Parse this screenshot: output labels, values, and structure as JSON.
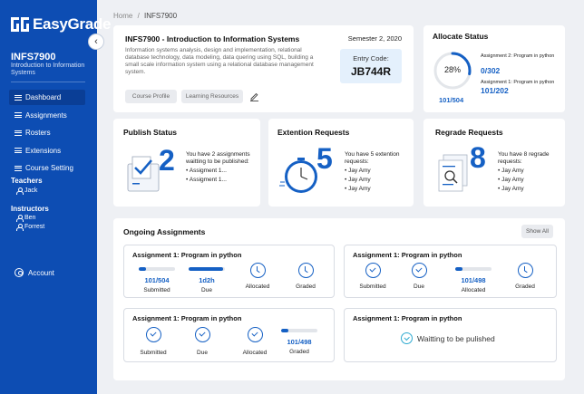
{
  "app": {
    "name": "EasyGrade"
  },
  "course": {
    "code": "INFS7900",
    "name": "Introduction to Information Systems"
  },
  "nav": [
    {
      "label": "Dashboard",
      "active": true
    },
    {
      "label": "Assignments",
      "active": false
    },
    {
      "label": "Rosters",
      "active": false
    },
    {
      "label": "Extensions",
      "active": false
    },
    {
      "label": "Course Setting",
      "active": false
    }
  ],
  "teachers": {
    "heading": "Teachers",
    "people": [
      "Jack"
    ]
  },
  "instructors": {
    "heading": "Instructors",
    "people": [
      "Ben",
      "Forrest"
    ]
  },
  "account": {
    "label": "Account"
  },
  "breadcrumb": {
    "home": "Home",
    "separator": "/",
    "current": "INFS7900"
  },
  "course_card": {
    "title": "INFS7900 - Introduction to Information Systems",
    "semester": "Semester 2, 2020",
    "description": "Information systems analysis, design and implementation, relational database technology, data modeling, data quering using SQL, building a small scale information system using a relational database management system.",
    "entry_label": "Entry Code:",
    "entry_code": "JB744R",
    "profile_btn": "Course Profile",
    "resources_btn": "Learning Resources"
  },
  "allocate": {
    "title": "Allocate Status",
    "percent": "28%",
    "percent_value": 0.28,
    "total": "101/504",
    "a2_label": "Assignment 2: Program in python",
    "a2_value": "0/302",
    "a1_label": "Assignment 1: Program in python",
    "a1_value": "101/202"
  },
  "publish": {
    "title": "Publish Status",
    "count": "2",
    "text": "You have 2 assignments waitting to be published:",
    "items": [
      "Assigment 1...",
      "Assigment 1..."
    ]
  },
  "extension": {
    "title": "Extention Requests",
    "count": "5",
    "text": "You have 5 extention requests:",
    "items": [
      "Jay Amy",
      "Jay Amy",
      "Jay Amy"
    ]
  },
  "regrade": {
    "title": "Regrade Requests",
    "count": "8",
    "text": "You have 8 regrade requests:",
    "items": [
      "Jay Amy",
      "Jay Amy",
      "Jay Amy"
    ]
  },
  "ongoing": {
    "title": "Ongoing Assignments",
    "show_all": "Show All",
    "assignments": [
      {
        "title": "Assignment 1: Program in python",
        "stats": [
          {
            "kind": "bar",
            "value": "101/504",
            "label": "Submitted",
            "progress": 0.2
          },
          {
            "kind": "bar",
            "value": "1d2h",
            "label": "Due",
            "progress": 0.95
          },
          {
            "kind": "clock",
            "label": "Allocated"
          },
          {
            "kind": "clock",
            "label": "Graded"
          }
        ]
      },
      {
        "title": "Assignment 1: Program in python",
        "stats": [
          {
            "kind": "check",
            "label": "Submitted"
          },
          {
            "kind": "check",
            "label": "Due"
          },
          {
            "kind": "bar",
            "value": "101/498",
            "label": "Allocated",
            "progress": 0.2
          },
          {
            "kind": "clock",
            "label": "Graded"
          }
        ]
      },
      {
        "title": "Assignment 1: Program in python",
        "stats": [
          {
            "kind": "check",
            "label": "Submitted"
          },
          {
            "kind": "check",
            "label": "Due"
          },
          {
            "kind": "check",
            "label": "Allocated"
          },
          {
            "kind": "bar",
            "value": "101/498",
            "label": "Graded",
            "progress": 0.2
          }
        ]
      },
      {
        "title": "Assignment 1: Program in python",
        "waiting": "Waitting to be pulished"
      }
    ]
  },
  "colors": {
    "sidebar": "#0d4db3",
    "accent": "#1560c4",
    "background": "#eef0f4"
  }
}
